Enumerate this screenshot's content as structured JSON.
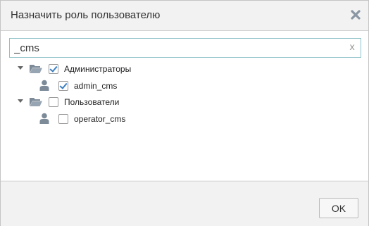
{
  "dialog": {
    "title": "Назначить роль пользователю",
    "close_icon": "close-icon"
  },
  "search": {
    "value": "_cms",
    "placeholder": "",
    "clear_label": "x"
  },
  "tree": [
    {
      "type": "group",
      "label": "Администраторы",
      "checked": true,
      "expanded": true,
      "icon": "folder-open-icon"
    },
    {
      "type": "user",
      "label": "admin_cms",
      "checked": true,
      "icon": "user-icon"
    },
    {
      "type": "group",
      "label": "Пользователи",
      "checked": false,
      "expanded": true,
      "icon": "folder-open-icon"
    },
    {
      "type": "user",
      "label": "operator_cms",
      "checked": false,
      "icon": "user-icon"
    }
  ],
  "footer": {
    "ok_label": "OK"
  },
  "colors": {
    "accent_border": "#8ec2c8",
    "icon_gray": "#7d8b99",
    "check": "#3a7fc0"
  }
}
